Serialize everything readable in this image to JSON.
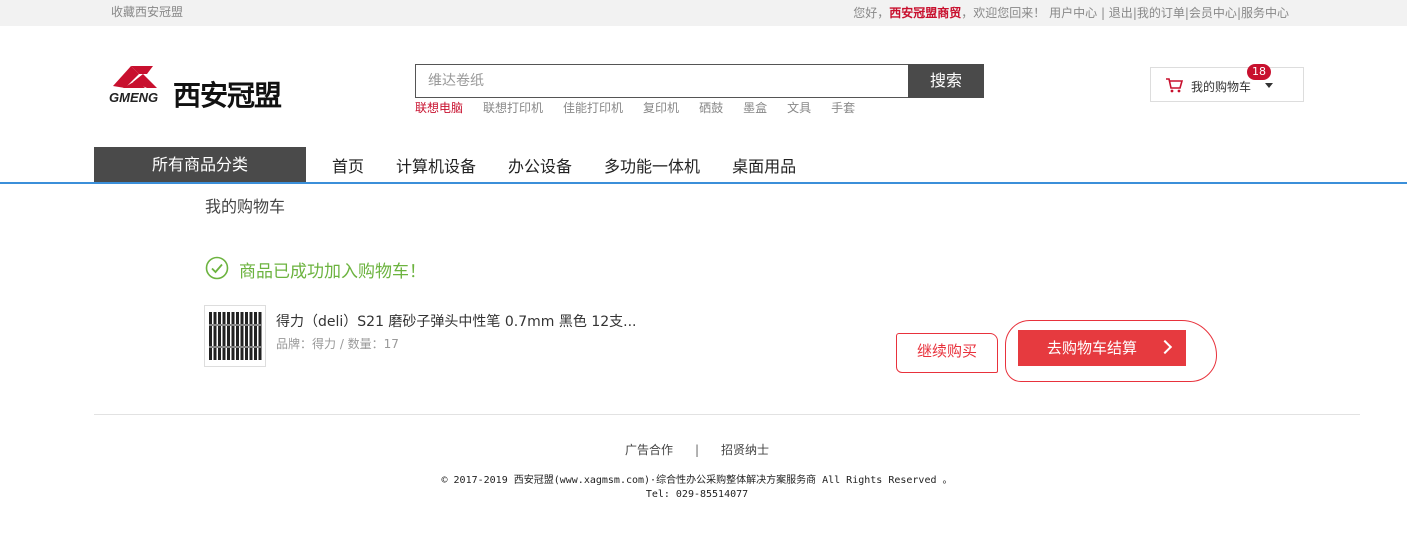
{
  "topbar": {
    "favorite": "收藏西安冠盟",
    "greeting_prefix": "您好，",
    "merchant": "西安冠盟商贸",
    "greeting_suffix": "，欢迎您回来！",
    "links": [
      "用户中心",
      "退出",
      "我的订单",
      "会员中心",
      "服务中心"
    ]
  },
  "logo": {
    "en": "GMENG",
    "cn": "西安冠盟"
  },
  "search": {
    "placeholder": "维达卷纸",
    "button": "搜索",
    "hotwords": [
      "联想电脑",
      "联想打印机",
      "佳能打印机",
      "复印机",
      "硒鼓",
      "墨盒",
      "文具",
      "手套"
    ]
  },
  "cart": {
    "label": "我的购物车",
    "count": "18"
  },
  "nav": {
    "all_categories": "所有商品分类",
    "links": [
      "首页",
      "计算机设备",
      "办公设备",
      "多功能一体机",
      "桌面用品"
    ]
  },
  "page": {
    "breadcrumb": "我的购物车",
    "success_message": "商品已成功加入购物车！"
  },
  "product": {
    "name": "得力（deli）S21 磨砂子弹头中性笔 0.7mm 黑色 12支...",
    "meta": "品牌：得力 / 数量：17"
  },
  "actions": {
    "continue": "继续购买",
    "checkout": "去购物车结算"
  },
  "footer": {
    "links": [
      "广告合作",
      "招贤纳士"
    ],
    "separator": "|",
    "copyright": "© 2017-2019 西安冠盟(www.xagmsm.com)·综合性办公采购整体解决方案服务商 All Rights Reserved 。",
    "tel": "Tel: 029-85514077"
  },
  "colors": {
    "accent_red": "#e63a3f",
    "brand_red": "#c8102e",
    "success_green": "#6cb33f",
    "nav_blue": "#3b8fd9",
    "dark_gray": "#4a4a4a"
  }
}
